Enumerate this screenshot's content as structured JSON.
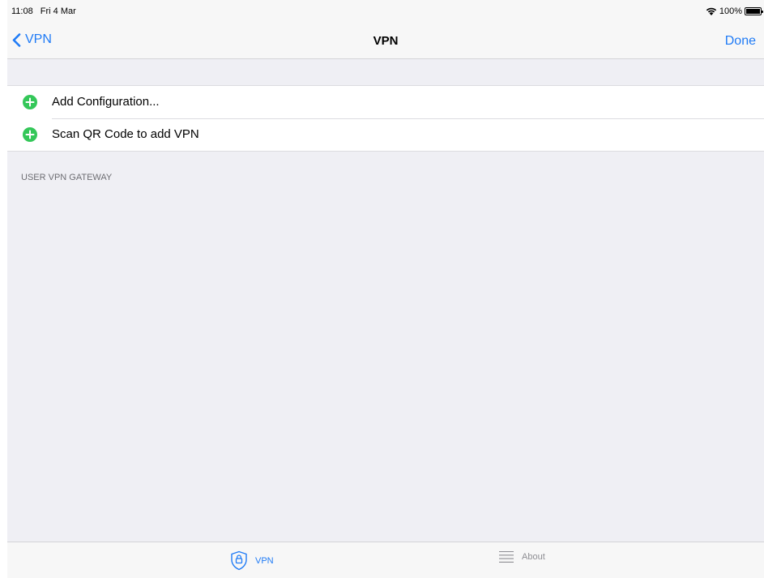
{
  "status_bar": {
    "time": "11:08",
    "date": "Fri 4 Mar",
    "battery": "100%"
  },
  "nav": {
    "back_label": "VPN",
    "title": "VPN",
    "done_label": "Done"
  },
  "list": {
    "items": [
      {
        "label": "Add Configuration...",
        "icon": "add-circle-icon"
      },
      {
        "label": "Scan QR Code to add VPN",
        "icon": "add-circle-icon"
      }
    ]
  },
  "section": {
    "header": "USER VPN GATEWAY"
  },
  "tab_bar": {
    "tabs": [
      {
        "label": "VPN",
        "icon": "shield-lock-icon",
        "selected": true
      },
      {
        "label": "About",
        "icon": "list-lines-icon",
        "selected": false
      }
    ]
  },
  "colors": {
    "accent": "#1f7bf6",
    "add_icon": "#34c759",
    "background": "#efeff4",
    "inactive_tab": "#8e8e93"
  }
}
